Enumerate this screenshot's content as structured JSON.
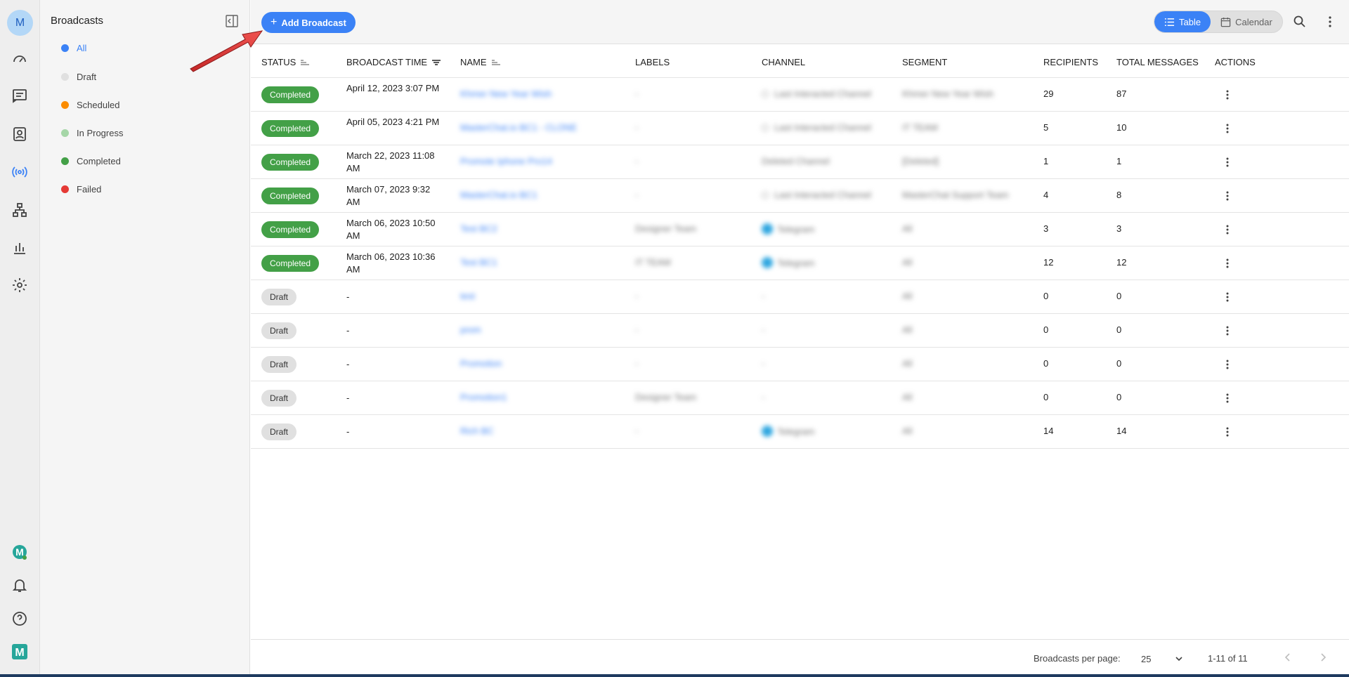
{
  "user": {
    "avatar_initial": "M"
  },
  "sidebar": {
    "title": "Broadcasts",
    "filters": [
      {
        "label": "All",
        "color": "#3b82f6",
        "active": true
      },
      {
        "label": "Draft",
        "color": "#e0e0e0"
      },
      {
        "label": "Scheduled",
        "color": "#fb8c00"
      },
      {
        "label": "In Progress",
        "color": "#a5d6a7"
      },
      {
        "label": "Completed",
        "color": "#43a047"
      },
      {
        "label": "Failed",
        "color": "#e53935"
      }
    ]
  },
  "header": {
    "add_button": "Add Broadcast",
    "view_table": "Table",
    "view_calendar": "Calendar"
  },
  "table": {
    "columns": {
      "status": "STATUS",
      "broadcast_time": "BROADCAST TIME",
      "name": "NAME",
      "labels": "LABELS",
      "channel": "CHANNEL",
      "segment": "SEGMENT",
      "recipients": "RECIPIENTS",
      "total_messages": "TOTAL MESSAGES",
      "actions": "ACTIONS"
    },
    "rows": [
      {
        "status": "Completed",
        "time": "April 12, 2023 3:07 PM",
        "name": "Khmer New Year Wish",
        "labels": "-",
        "channel": "Last Interacted Channel",
        "channel_type": "generic",
        "segment": "Khmer New Year Wish",
        "recipients": "29",
        "total": "87"
      },
      {
        "status": "Completed",
        "time": "April 05, 2023 4:21 PM",
        "name": "MasterChat.io BC1 - CLONE",
        "labels": "-",
        "channel": "Last Interacted Channel",
        "channel_type": "generic",
        "segment": "IT TEAM",
        "recipients": "5",
        "total": "10"
      },
      {
        "status": "Completed",
        "time": "March 22, 2023 11:08 AM",
        "name": "Promote Iphone Pro14",
        "labels": "-",
        "channel": "Deleted Channel",
        "channel_type": "none",
        "segment": "[Deleted]",
        "recipients": "1",
        "total": "1"
      },
      {
        "status": "Completed",
        "time": "March 07, 2023 9:32 AM",
        "name": "MasterChat.io BC1",
        "labels": "-",
        "channel": "Last Interacted Channel",
        "channel_type": "generic",
        "segment": "MasterChat Support Team",
        "recipients": "4",
        "total": "8"
      },
      {
        "status": "Completed",
        "time": "March 06, 2023 10:50 AM",
        "name": "Test BC2",
        "labels": "Designer Team",
        "channel": "Telegram",
        "channel_type": "telegram",
        "segment": "All",
        "recipients": "3",
        "total": "3"
      },
      {
        "status": "Completed",
        "time": "March 06, 2023 10:36 AM",
        "name": "Test BC1",
        "labels": "IT TEAM",
        "channel": "Telegram",
        "channel_type": "telegram",
        "segment": "All",
        "recipients": "12",
        "total": "12"
      },
      {
        "status": "Draft",
        "time": "-",
        "name": "test",
        "labels": "-",
        "channel": "-",
        "channel_type": "none",
        "segment": "All",
        "recipients": "0",
        "total": "0"
      },
      {
        "status": "Draft",
        "time": "-",
        "name": "prom",
        "labels": "-",
        "channel": "-",
        "channel_type": "none",
        "segment": "All",
        "recipients": "0",
        "total": "0"
      },
      {
        "status": "Draft",
        "time": "-",
        "name": "Promotion",
        "labels": "-",
        "channel": "-",
        "channel_type": "none",
        "segment": "All",
        "recipients": "0",
        "total": "0"
      },
      {
        "status": "Draft",
        "time": "-",
        "name": "Promotion1",
        "labels": "Designer Team",
        "channel": "-",
        "channel_type": "none",
        "segment": "All",
        "recipients": "0",
        "total": "0"
      },
      {
        "status": "Draft",
        "time": "-",
        "name": "Rich BC",
        "labels": "-",
        "channel": "Telegram",
        "channel_type": "telegram",
        "segment": "All",
        "recipients": "14",
        "total": "14"
      }
    ]
  },
  "footer": {
    "per_page_label": "Broadcasts per page:",
    "per_page_value": "25",
    "range": "1-11 of 11"
  }
}
